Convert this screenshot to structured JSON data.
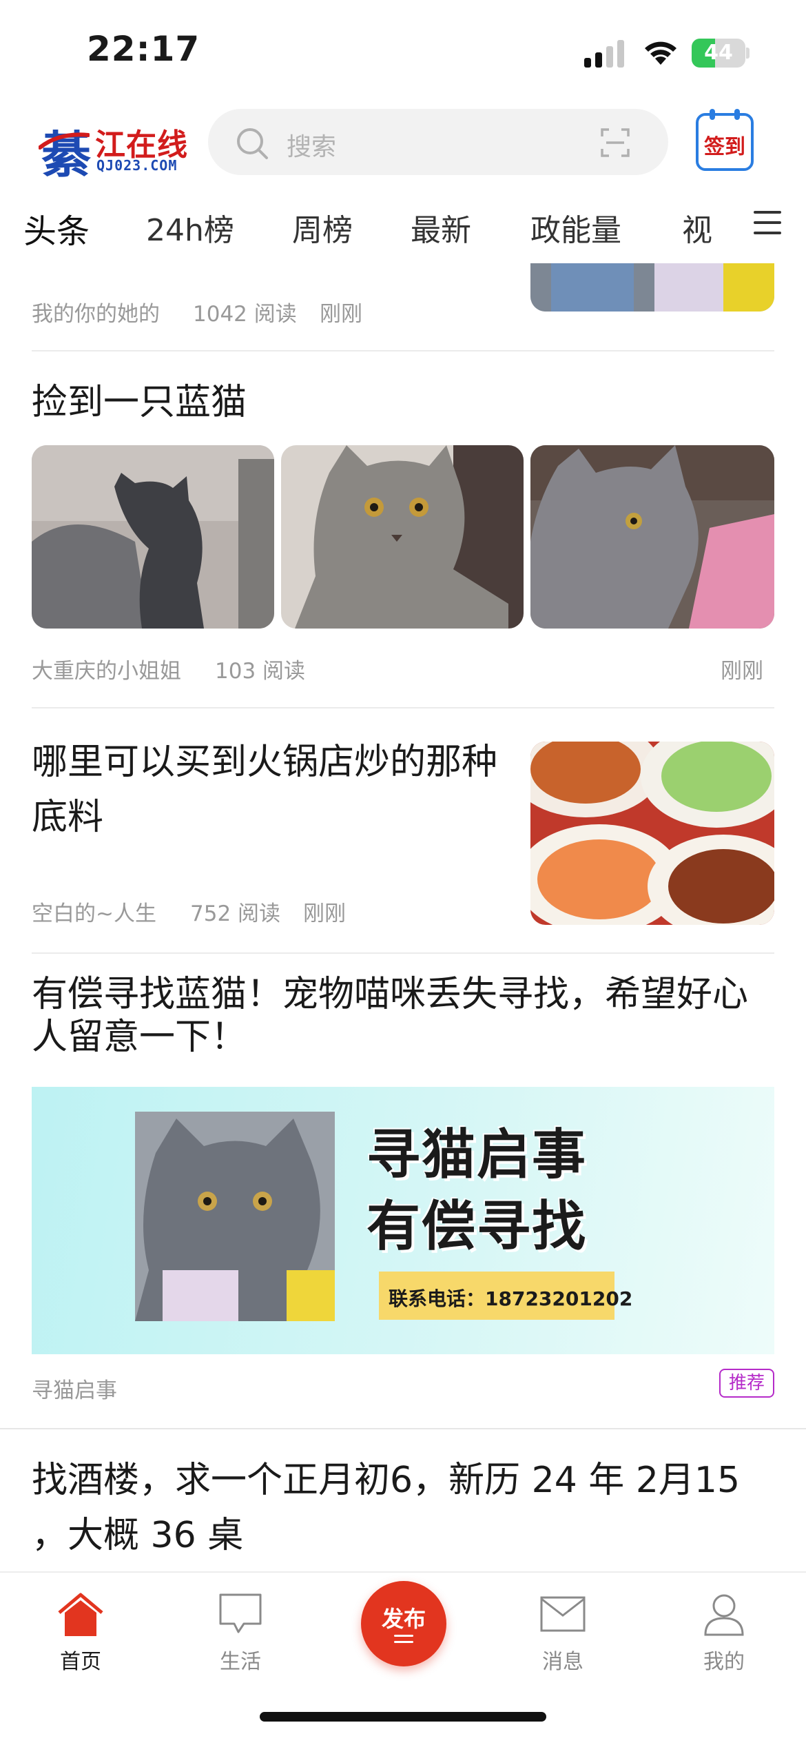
{
  "status_bar": {
    "time": "22:17",
    "battery": "44",
    "battery_level": 0.44
  },
  "header": {
    "logo_char": "綦",
    "logo_name": "江在线",
    "logo_url": "QJ023.COM",
    "search_placeholder": "搜索",
    "checkin_label": "签到"
  },
  "tabs": [
    "头条",
    "24h榜",
    "周榜",
    "最新",
    "政能量",
    "视"
  ],
  "feed": {
    "item0": {
      "author": "我的你的她的",
      "reads": "1042 阅读",
      "time": "刚刚"
    },
    "item1": {
      "title": "捡到一只蓝猫",
      "author": "大重庆的小姐姐",
      "reads": "103 阅读",
      "time": "刚刚"
    },
    "item2": {
      "title": "哪里可以买到火锅店炒的那种底料",
      "author": "空白的~人生",
      "reads": "752 阅读",
      "time": "刚刚"
    },
    "item3": {
      "title": "有偿寻找蓝猫！宠物喵咪丢失寻找，希望好心人留意一下！",
      "banner_line1": "寻猫启事",
      "banner_line2": "有偿寻找",
      "banner_contact": "联系电话：18723201202",
      "source": "寻猫启事",
      "badge": "推荐"
    },
    "item4": {
      "title": "找酒楼，求一个正月初6，新历 24 年 2月15 ，大概 36 桌"
    }
  },
  "tabbar": {
    "home": "首页",
    "life": "生活",
    "publish": "发布",
    "messages": "消息",
    "mine": "我的"
  },
  "colors": {
    "accent": "#e2351f",
    "brand_blue": "#1d4ab3",
    "brand_red": "#d21c1c"
  }
}
